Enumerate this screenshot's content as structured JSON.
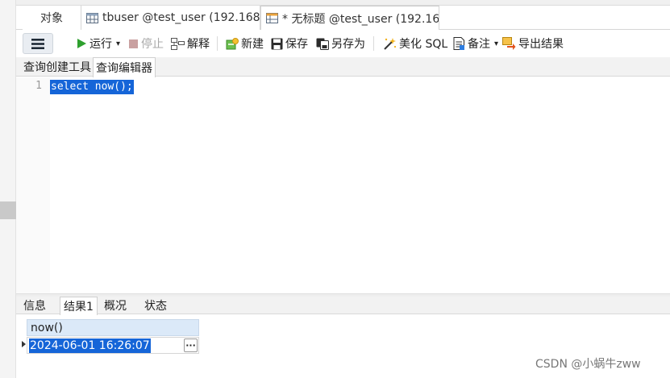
{
  "tabs": [
    {
      "label": "对象",
      "icon": "none",
      "active": false
    },
    {
      "label": "tbuser @test_user (192.168....",
      "icon": "table-icon",
      "active": false
    },
    {
      "label": "* 无标题 @test_user (192.16...",
      "icon": "query-icon",
      "active": true
    }
  ],
  "toolbar": {
    "menu_icon": "hamburger-icon",
    "run": "运行",
    "stop": "停止",
    "explain": "解释",
    "new": "新建",
    "save": "保存",
    "save_as": "另存为",
    "beautify": "美化 SQL",
    "comment": "备注",
    "export": "导出结果"
  },
  "subtabs": [
    "查询创建工具",
    "查询编辑器"
  ],
  "editor": {
    "line_number": "1",
    "sql": "select now();"
  },
  "result_tabs": [
    "信息",
    "结果1",
    "概况",
    "状态"
  ],
  "result": {
    "column": "now()",
    "value": "2024-06-01 16:26:07",
    "ellipsis": "···"
  },
  "watermark": "CSDN @小蜗牛zww",
  "colors": {
    "selection": "#1565d8",
    "header": "#dbe9f8",
    "run_green": "#2ea02e",
    "stop_gray": "#b0b0b0"
  }
}
